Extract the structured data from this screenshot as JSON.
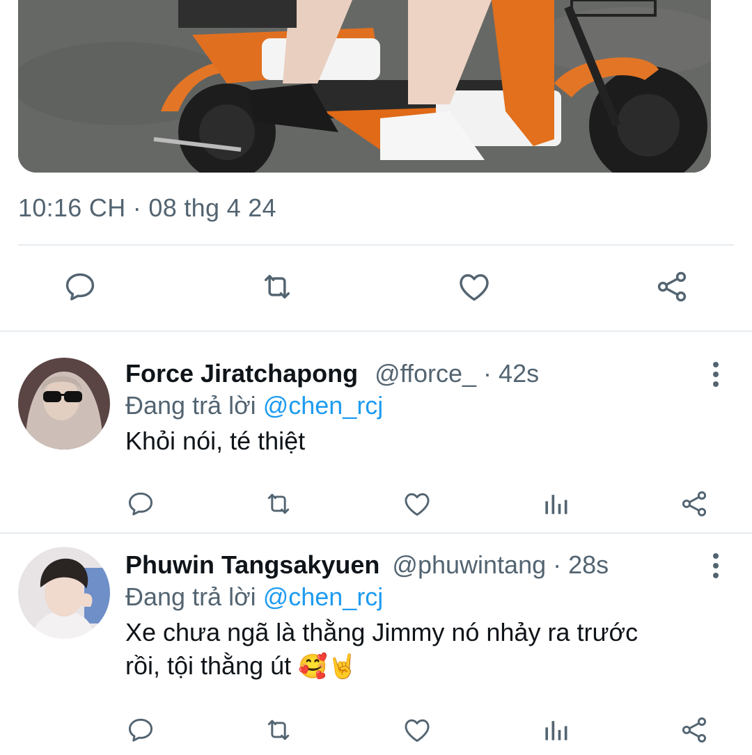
{
  "tweet": {
    "photo_alt": "two people riding an orange electric scooter",
    "timestamp": "10:16 CH · 08 thg 4 24",
    "actions": [
      "reply-icon",
      "retweet-icon",
      "like-icon",
      "share-icon"
    ]
  },
  "replies": [
    {
      "name": "Force Jiratchapong",
      "handle": "@fforce_",
      "separator": " · ",
      "time": "42s",
      "replying_prefix": "Đang trả lời ",
      "replying_to": "@chen_rcj",
      "text_line1": "Khỏi nói, té thiệt",
      "text_line2": "",
      "emoji": ""
    },
    {
      "name": "Phuwin Tangsakyuen",
      "handle": "@phuwintang",
      "separator": " · ",
      "time": "28s",
      "replying_prefix": "Đang trả lời ",
      "replying_to": "@chen_rcj",
      "text_line1": "Xe chưa ngã là thằng Jimmy nó nhảy ra trước",
      "text_line2": "rồi, tội thằng út ",
      "emoji": "🥰🤘"
    }
  ],
  "colors": {
    "accent": "#1d9bf0",
    "muted": "#536471",
    "text": "#0f1419"
  }
}
